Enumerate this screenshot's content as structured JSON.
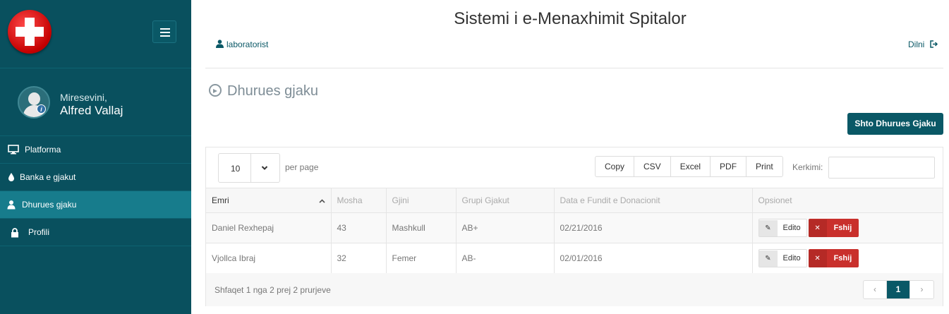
{
  "app": {
    "title": "Sistemi i e-Menaxhimit Spitalor"
  },
  "header": {
    "user": "laboratorist",
    "logout": "Dilni"
  },
  "sidebar": {
    "welcome": "Miresevini,",
    "username": "Alfred Vallaj",
    "items": [
      {
        "label": "Platforma",
        "icon": "monitor-icon"
      },
      {
        "label": "Banka e gjakut",
        "icon": "droplet-icon"
      },
      {
        "label": "Dhurues gjaku",
        "icon": "user-icon",
        "active": true
      },
      {
        "label": "Profili",
        "icon": "lock-icon"
      }
    ]
  },
  "page": {
    "heading": "Dhurues gjaku",
    "add_button": "Shto Dhurues Gjaku"
  },
  "table_controls": {
    "per_page_value": "10",
    "per_page_label": "per page",
    "export": [
      "Copy",
      "CSV",
      "Excel",
      "PDF",
      "Print"
    ],
    "search_label": "Kerkimi:",
    "search_value": ""
  },
  "table": {
    "columns": [
      "Emri",
      "Mosha",
      "Gjini",
      "Grupi Gjakut",
      "Data e Fundit e Donacionit",
      "Opsionet"
    ],
    "rows": [
      [
        "Daniel Rexhepaj",
        "43",
        "Mashkull",
        "AB+",
        "02/21/2016"
      ],
      [
        "Vjollca Ibraj",
        "32",
        "Femer",
        "AB-",
        "02/01/2016"
      ]
    ],
    "edit_label": "Edito",
    "delete_label": "Fshij"
  },
  "footer": {
    "info": "Shfaqet 1 nga 2 prej 2 prurjeve",
    "pager": [
      "‹",
      "1",
      "›"
    ]
  },
  "colors": {
    "sidebar": "#09505e",
    "active": "#177c8c",
    "primary": "#0a5866",
    "danger": "#c9302c"
  }
}
